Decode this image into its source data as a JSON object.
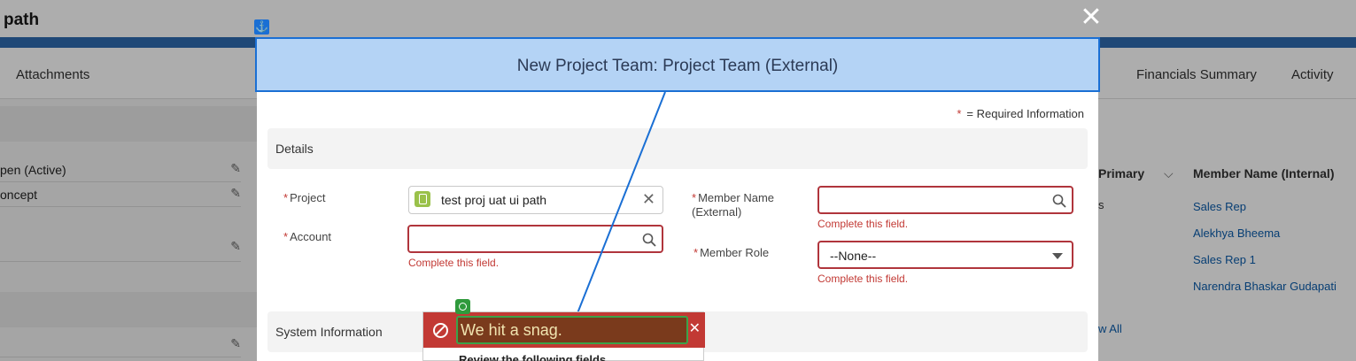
{
  "background": {
    "title": "path",
    "tabs_left": [
      "Attachments"
    ],
    "tabs_right": [
      "Financials Summary",
      "Activity"
    ],
    "rows": [
      "pen (Active)",
      "oncept"
    ],
    "table": {
      "headers": [
        "Primary",
        "Member Name (Internal)"
      ],
      "col1_fragment": "s",
      "members": [
        "Sales Rep",
        "Alekhya Bheema",
        "Sales Rep 1",
        "Narendra Bhaskar Gudapati"
      ],
      "view_all": "w All"
    }
  },
  "modal": {
    "title": "New Project Team: Project Team (External)",
    "close": "✕",
    "required_star": "*",
    "required_note": "= Required Information",
    "details_section": "Details",
    "system_section": "System Information",
    "fields": {
      "project": {
        "label": "Project",
        "value": "test proj uat ui path",
        "clear": "✕"
      },
      "account": {
        "label": "Account",
        "value": "",
        "error": "Complete this field."
      },
      "member_name": {
        "label_line1": "Member Name",
        "label_line2": "(External)",
        "value": "",
        "error": "Complete this field."
      },
      "member_role": {
        "label": "Member Role",
        "selected": "--None--",
        "error": "Complete this field."
      }
    }
  },
  "toast": {
    "title": "We hit a snag.",
    "close": "✕",
    "body": "Review the following fields"
  },
  "colors": {
    "error": "#c23934",
    "link": "#0b5cab",
    "accent": "#1a6fd4"
  },
  "icons": [
    "anchor-icon",
    "close-icon",
    "lookup-record-icon",
    "search-icon",
    "chevron-down-icon",
    "error-icon",
    "target-icon",
    "edit-pencil-icon"
  ]
}
